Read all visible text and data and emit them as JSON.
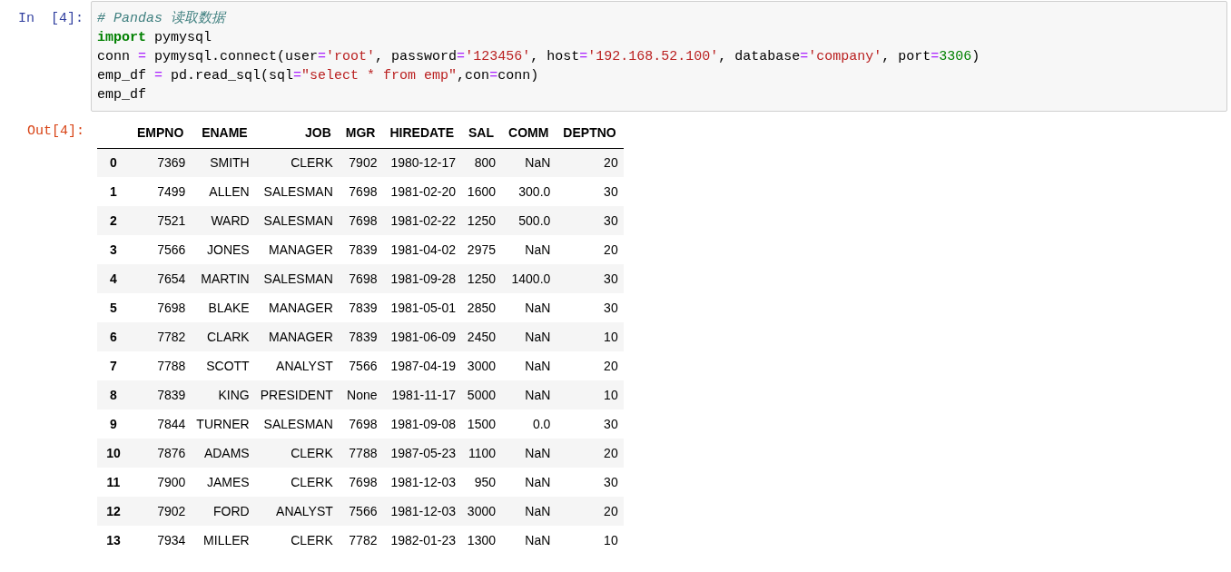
{
  "input_cell": {
    "prompt": "In  [4]:",
    "lines": [
      [
        {
          "kind": "comment",
          "text": "# Pandas 读取数据"
        }
      ],
      [
        {
          "kind": "keyword",
          "text": "import"
        },
        {
          "kind": "plain",
          "text": " pymysql"
        }
      ],
      [
        {
          "kind": "plain",
          "text": "conn "
        },
        {
          "kind": "operator",
          "text": "="
        },
        {
          "kind": "plain",
          "text": " pymysql.connect(user"
        },
        {
          "kind": "operator",
          "text": "="
        },
        {
          "kind": "string",
          "text": "'root'"
        },
        {
          "kind": "plain",
          "text": ", password"
        },
        {
          "kind": "operator",
          "text": "="
        },
        {
          "kind": "string",
          "text": "'123456'"
        },
        {
          "kind": "plain",
          "text": ", host"
        },
        {
          "kind": "operator",
          "text": "="
        },
        {
          "kind": "string",
          "text": "'192.168.52.100'"
        },
        {
          "kind": "plain",
          "text": ", database"
        },
        {
          "kind": "operator",
          "text": "="
        },
        {
          "kind": "string",
          "text": "'company'"
        },
        {
          "kind": "plain",
          "text": ", port"
        },
        {
          "kind": "operator",
          "text": "="
        },
        {
          "kind": "number",
          "text": "3306"
        },
        {
          "kind": "plain",
          "text": ")"
        }
      ],
      [
        {
          "kind": "plain",
          "text": "emp_df "
        },
        {
          "kind": "operator",
          "text": "="
        },
        {
          "kind": "plain",
          "text": " pd.read_sql(sql"
        },
        {
          "kind": "operator",
          "text": "="
        },
        {
          "kind": "string",
          "text": "\"select * from emp\""
        },
        {
          "kind": "plain",
          "text": ",con"
        },
        {
          "kind": "operator",
          "text": "="
        },
        {
          "kind": "plain",
          "text": "conn)"
        }
      ],
      [
        {
          "kind": "plain",
          "text": "emp_df"
        }
      ]
    ]
  },
  "output_cell": {
    "prompt": "Out[4]:",
    "table": {
      "columns": [
        "EMPNO",
        "ENAME",
        "JOB",
        "MGR",
        "HIREDATE",
        "SAL",
        "COMM",
        "DEPTNO"
      ],
      "rows": [
        {
          "index": "0",
          "cells": [
            "7369",
            "SMITH",
            "CLERK",
            "7902",
            "1980-12-17",
            "800",
            "NaN",
            "20"
          ]
        },
        {
          "index": "1",
          "cells": [
            "7499",
            "ALLEN",
            "SALESMAN",
            "7698",
            "1981-02-20",
            "1600",
            "300.0",
            "30"
          ]
        },
        {
          "index": "2",
          "cells": [
            "7521",
            "WARD",
            "SALESMAN",
            "7698",
            "1981-02-22",
            "1250",
            "500.0",
            "30"
          ]
        },
        {
          "index": "3",
          "cells": [
            "7566",
            "JONES",
            "MANAGER",
            "7839",
            "1981-04-02",
            "2975",
            "NaN",
            "20"
          ]
        },
        {
          "index": "4",
          "cells": [
            "7654",
            "MARTIN",
            "SALESMAN",
            "7698",
            "1981-09-28",
            "1250",
            "1400.0",
            "30"
          ]
        },
        {
          "index": "5",
          "cells": [
            "7698",
            "BLAKE",
            "MANAGER",
            "7839",
            "1981-05-01",
            "2850",
            "NaN",
            "30"
          ]
        },
        {
          "index": "6",
          "cells": [
            "7782",
            "CLARK",
            "MANAGER",
            "7839",
            "1981-06-09",
            "2450",
            "NaN",
            "10"
          ]
        },
        {
          "index": "7",
          "cells": [
            "7788",
            "SCOTT",
            "ANALYST",
            "7566",
            "1987-04-19",
            "3000",
            "NaN",
            "20"
          ]
        },
        {
          "index": "8",
          "cells": [
            "7839",
            "KING",
            "PRESIDENT",
            "None",
            "1981-11-17",
            "5000",
            "NaN",
            "10"
          ]
        },
        {
          "index": "9",
          "cells": [
            "7844",
            "TURNER",
            "SALESMAN",
            "7698",
            "1981-09-08",
            "1500",
            "0.0",
            "30"
          ]
        },
        {
          "index": "10",
          "cells": [
            "7876",
            "ADAMS",
            "CLERK",
            "7788",
            "1987-05-23",
            "1100",
            "NaN",
            "20"
          ]
        },
        {
          "index": "11",
          "cells": [
            "7900",
            "JAMES",
            "CLERK",
            "7698",
            "1981-12-03",
            "950",
            "NaN",
            "30"
          ]
        },
        {
          "index": "12",
          "cells": [
            "7902",
            "FORD",
            "ANALYST",
            "7566",
            "1981-12-03",
            "3000",
            "NaN",
            "20"
          ]
        },
        {
          "index": "13",
          "cells": [
            "7934",
            "MILLER",
            "CLERK",
            "7782",
            "1982-01-23",
            "1300",
            "NaN",
            "10"
          ]
        }
      ]
    }
  }
}
